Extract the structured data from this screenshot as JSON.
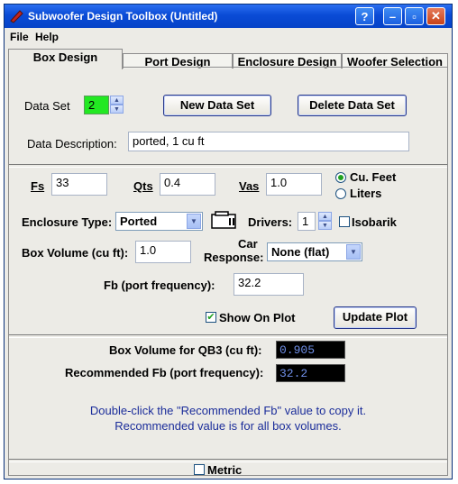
{
  "window": {
    "title": "Subwoofer Design Toolbox  (Untitled)",
    "help_btn": "?",
    "minimize_btn": "–",
    "maximize_btn": "▫",
    "close_btn": "✕"
  },
  "menu": [
    "File",
    "Help"
  ],
  "tabs": [
    "Box Design",
    "Port Design",
    "Enclosure Design",
    "Woofer Selection"
  ],
  "dataset": {
    "label": "Data Set",
    "value": "2",
    "new_btn": "New Data Set",
    "delete_btn": "Delete Data Set",
    "desc_label": "Data Description:",
    "desc_value": "ported, 1 cu ft"
  },
  "params": {
    "fs_label": "Fs",
    "fs_value": "33",
    "qts_label": "Qts",
    "qts_value": "0.4",
    "vas_label": "Vas",
    "vas_value": "1.0",
    "unit_cu_feet": "Cu. Feet",
    "unit_liters": "Liters"
  },
  "enclosure": {
    "type_label": "Enclosure Type:",
    "type_value": "Ported",
    "drivers_label": "Drivers:",
    "drivers_value": "1",
    "isobarik_label": "Isobarik",
    "box_volume_label": "Box Volume (cu ft):",
    "box_volume_value": "1.0",
    "car_response_label_1": "Car",
    "car_response_label_2": "Response:",
    "car_response_value": "None (flat)",
    "fb_label": "Fb (port frequency):",
    "fb_value": "32.2",
    "show_on_plot_label": "Show On Plot",
    "update_btn": "Update Plot"
  },
  "results": {
    "qb3_label": "Box Volume for QB3 (cu ft):",
    "qb3_value": "0.905",
    "rec_fb_label": "Recommended Fb (port frequency):",
    "rec_fb_value": "32.2",
    "note_line1": "Double-click the \"Recommended Fb\" value to copy it.",
    "note_line2": "Recommended value is for all box volumes."
  },
  "footer": {
    "metric_label": "Metric"
  },
  "colors": {
    "title_blue": "#0a4bd6",
    "spin_green": "#22e822",
    "note_blue": "#1b2d9a"
  }
}
